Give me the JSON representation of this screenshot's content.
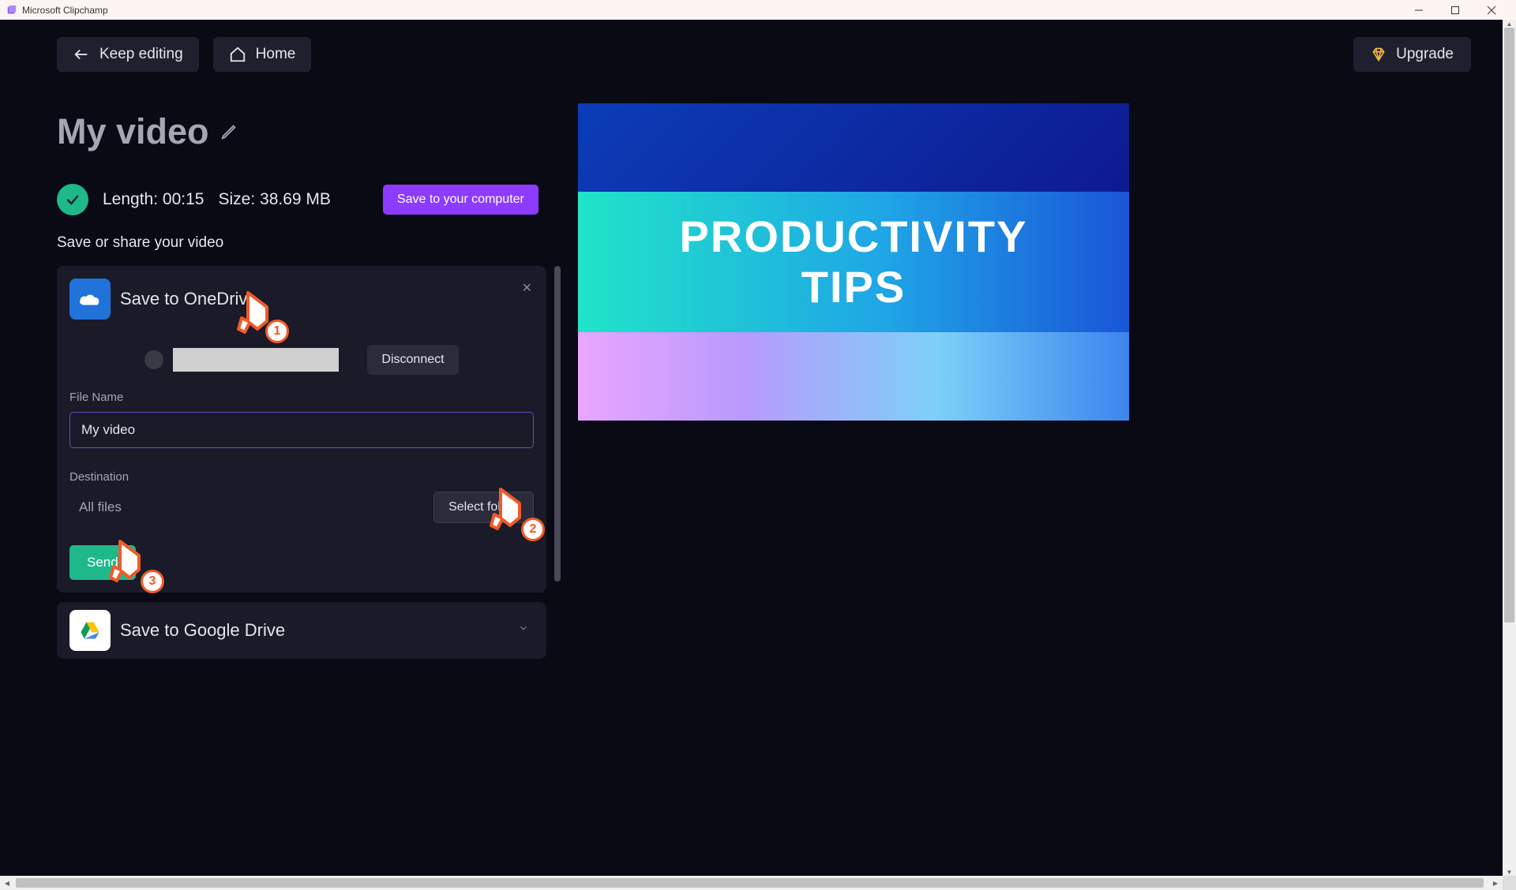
{
  "app": {
    "title": "Microsoft Clipchamp"
  },
  "topbar": {
    "keep_editing": "Keep editing",
    "home": "Home",
    "upgrade": "Upgrade"
  },
  "video": {
    "title": "My video",
    "length_label": "Length:",
    "length_value": "00:15",
    "size_label": "Size:",
    "size_value": "38.69 MB",
    "save_computer": "Save to your computer"
  },
  "save_share": {
    "heading": "Save or share your video",
    "onedrive": {
      "title": "Save to OneDrive",
      "disconnect": "Disconnect",
      "file_name_label": "File Name",
      "file_name_value": "My video",
      "destination_label": "Destination",
      "destination_value": "All files",
      "select_folder": "Select folder",
      "send": "Send"
    },
    "gdrive": {
      "title": "Save to Google Drive"
    }
  },
  "preview": {
    "line1": "PRODUCTIVITY",
    "line2": "TIPS"
  },
  "callouts": {
    "c1": "1",
    "c2": "2",
    "c3": "3"
  }
}
